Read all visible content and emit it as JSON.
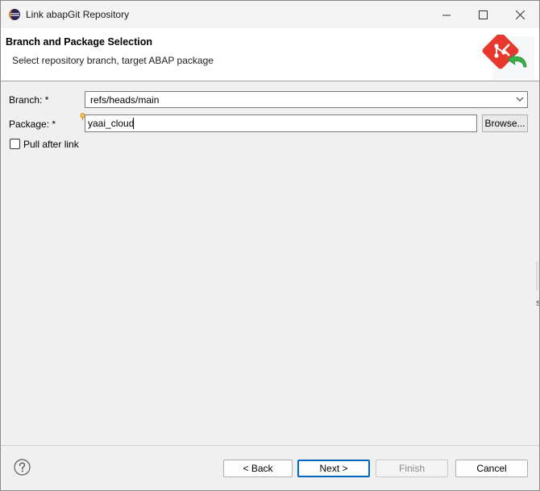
{
  "window": {
    "title": "Link abapGit Repository",
    "icon": "eclipse-icon"
  },
  "banner": {
    "title": "Branch and Package Selection",
    "description": "Select repository branch, target ABAP package",
    "graphic": "abapgit-link-icon"
  },
  "form": {
    "branch_label": "Branch: *",
    "branch_value": "refs/heads/main",
    "package_label": "Package: *",
    "package_value": "yaai_cloud",
    "browse_label": "Browse...",
    "pull_after_link_label": "Pull after link",
    "pull_after_link_checked": false
  },
  "footer": {
    "back_label": "< Back",
    "next_label": "Next >",
    "finish_label": "Finish",
    "cancel_label": "Cancel"
  },
  "edge": {
    "char": "s"
  },
  "colors": {
    "accent": "#0067c0",
    "disabled_text": "#8a8a8a",
    "abapgit_red": "#e8382d",
    "abapgit_green": "#3bb04a"
  }
}
